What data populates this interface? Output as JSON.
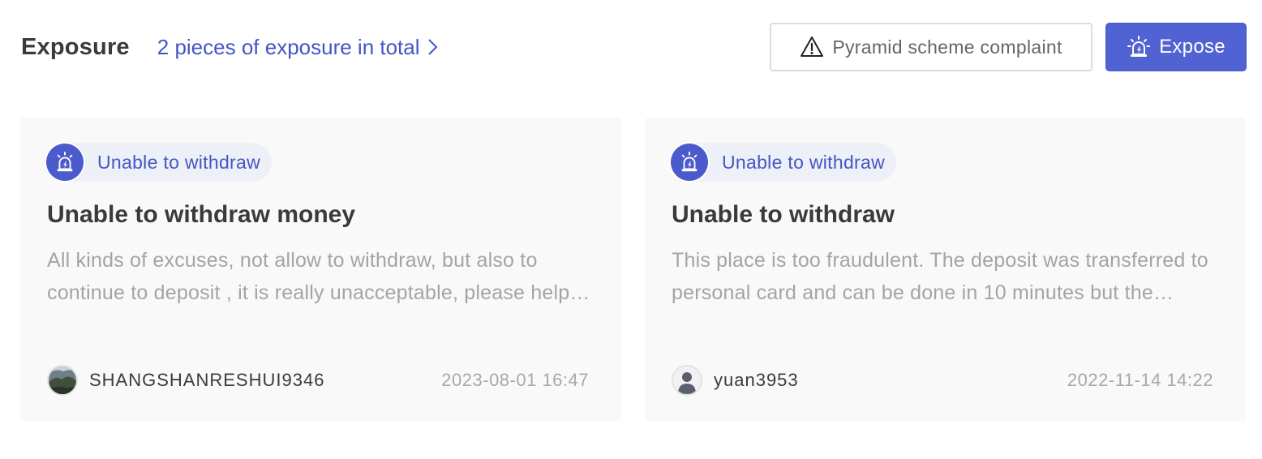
{
  "header": {
    "title": "Exposure",
    "total_link": "2 pieces of exposure in total",
    "complaint_button": "Pyramid scheme complaint",
    "expose_button": "Expose",
    "complaint_icon": "warning-triangle-icon",
    "expose_icon": "alarm-siren-icon",
    "accent_color": "#5162d3"
  },
  "cards": [
    {
      "tag": "Unable to withdraw",
      "title": "Unable to withdraw money",
      "description": "All kinds of excuses, not allow to withdraw, but also to continue to deposit , it is really unacceptable, please help me get my money back",
      "user": "SHANGSHANRESHUI9346",
      "date": "2023-08-01 16:47",
      "avatar_icon": "photo-avatar"
    },
    {
      "tag": "Unable to withdraw",
      "title": "Unable to withdraw",
      "description": "This place is too fraudulent. The deposit was transferred to personal card and can be done in 10 minutes but the withdrawal never arrives",
      "user": "yuan3953",
      "date": "2022-11-14 14:22",
      "avatar_icon": "default-user-avatar"
    }
  ]
}
